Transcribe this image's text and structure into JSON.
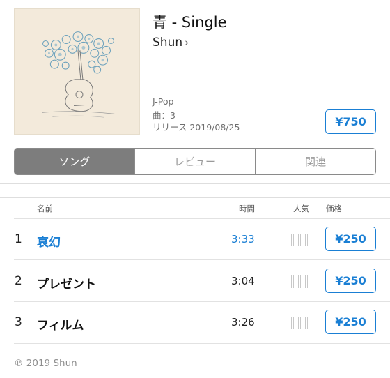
{
  "album": {
    "title": "青 - Single",
    "artist": "Shun",
    "artist_chevron": "›",
    "genre": "J-Pop",
    "track_count": "曲：3",
    "release": "リリース 2019/08/25",
    "price": "¥750",
    "artwork_icon": "album-artwork-guitar-flowers"
  },
  "tabs": [
    {
      "label": "ソング",
      "active": true
    },
    {
      "label": "レビュー",
      "active": false
    },
    {
      "label": "関連",
      "active": false
    }
  ],
  "columns": {
    "name": "名前",
    "time": "時間",
    "popularity": "人気",
    "price": "価格"
  },
  "tracks": [
    {
      "number": "1",
      "title": "哀幻",
      "time": "3:33",
      "price": "¥250",
      "playing": true
    },
    {
      "number": "2",
      "title": "プレゼント",
      "time": "3:04",
      "price": "¥250",
      "playing": false
    },
    {
      "number": "3",
      "title": "フィルム",
      "time": "3:26",
      "price": "¥250",
      "playing": false
    }
  ],
  "footer": {
    "copyright": "℗ 2019 Shun"
  },
  "colors": {
    "accent": "#1a7fd4",
    "segment_active": "#7d7d7d",
    "artwork_bg": "#f3eadb"
  }
}
